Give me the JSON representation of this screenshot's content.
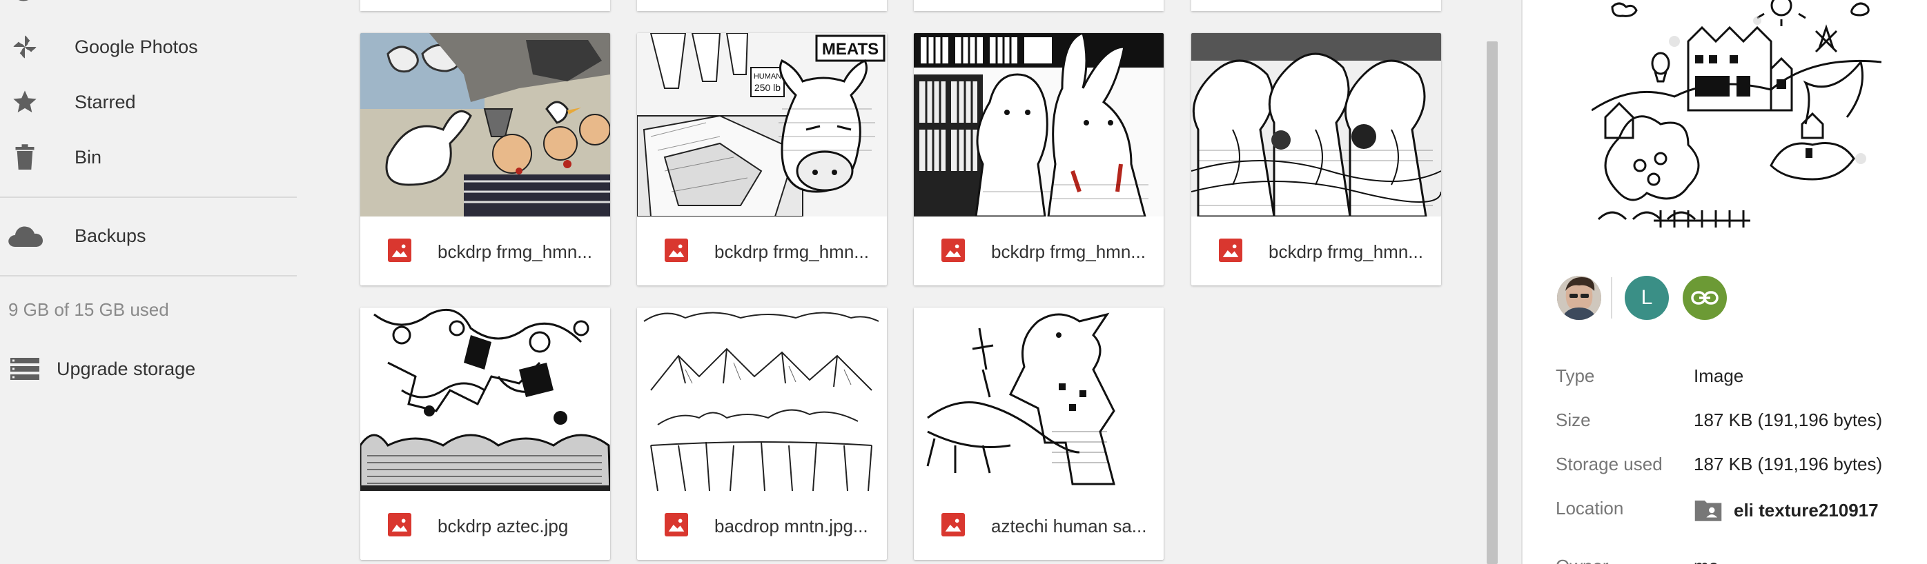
{
  "sidebar": {
    "items": [
      {
        "label": "Google Photos",
        "icon": "pinwheel-icon"
      },
      {
        "label": "Starred",
        "icon": "star-icon"
      },
      {
        "label": "Bin",
        "icon": "trash-icon"
      }
    ],
    "backups": {
      "label": "Backups",
      "icon": "cloud-icon"
    },
    "storage": {
      "text": "9 GB of 15 GB used",
      "used_gb": 9,
      "total_gb": 15
    },
    "upgrade": {
      "label": "Upgrade storage",
      "icon": "storage-icon"
    }
  },
  "files": [
    {
      "name": "bckdrp frmg_hmn..."
    },
    {
      "name": "bckdrp frmg_hmn..."
    },
    {
      "name": "bckdrp frmg_hmn..."
    },
    {
      "name": "bckdrp frmg_hmn..."
    },
    {
      "name": "bckdrp aztec.jpg"
    },
    {
      "name": "bacdrop mntn.jpg..."
    },
    {
      "name": "aztechi human sa..."
    }
  ],
  "thumbnail_text": {
    "meats_sign": "MEATS",
    "human_tag_line1": "HUMAN",
    "human_tag_line2": "250 lb"
  },
  "details": {
    "avatar_letter": "L",
    "colors": {
      "avatar_l": "#3a8f86",
      "link": "#6c9a35",
      "file_icon": "#d9372f"
    },
    "properties": [
      {
        "key": "Type",
        "value": "Image"
      },
      {
        "key": "Size",
        "value": "187 KB (191,196 bytes)"
      },
      {
        "key": "Storage used",
        "value": "187 KB (191,196 bytes)"
      },
      {
        "key": "Location",
        "value": "eli texture210917"
      },
      {
        "key": "Owner",
        "value": "me"
      }
    ]
  }
}
